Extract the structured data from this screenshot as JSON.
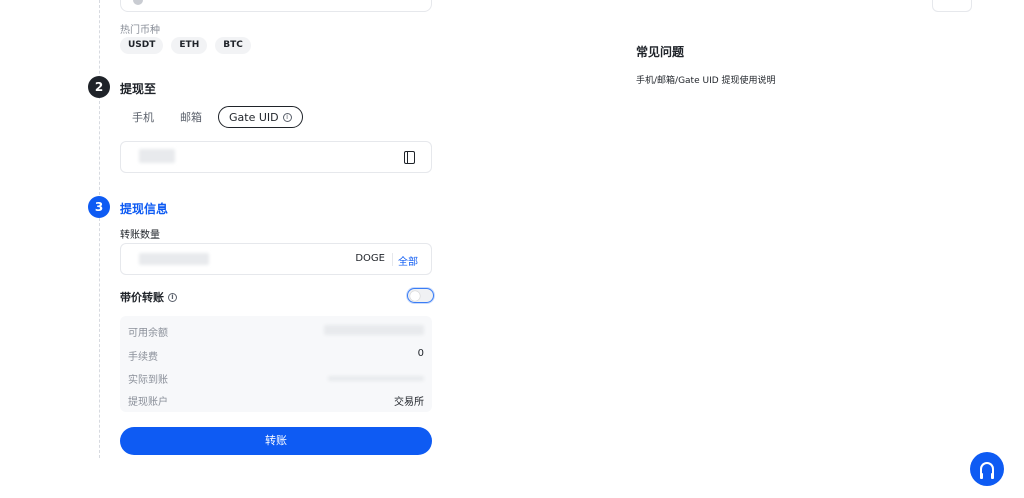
{
  "hot_coins": {
    "label": "热门币种",
    "items": [
      "USDT",
      "ETH",
      "BTC"
    ]
  },
  "step2": {
    "number": "2",
    "title": "提现至",
    "tabs": [
      {
        "label": "手机",
        "active": false
      },
      {
        "label": "邮箱",
        "active": false
      },
      {
        "label": "Gate UID",
        "active": true
      }
    ],
    "uid_input": {
      "value": ""
    }
  },
  "step3": {
    "number": "3",
    "title": "提现信息",
    "amount": {
      "label": "转账数量",
      "unit": "DOGE",
      "all_label": "全部"
    },
    "price_transfer": {
      "label": "带价转账",
      "enabled": false
    },
    "summary": [
      {
        "key": "可用余额",
        "value": ""
      },
      {
        "key": "手续费",
        "value": "0"
      },
      {
        "key": "实际到账",
        "value": ""
      },
      {
        "key": "提现账户",
        "value": "交易所"
      }
    ],
    "submit_label": "转账"
  },
  "faq": {
    "title": "常见问题",
    "links": [
      "手机/邮箱/Gate UID 提现使用说明"
    ]
  },
  "colors": {
    "primary": "#0e5bf3",
    "text": "#1f2329",
    "muted": "#8a8f99"
  }
}
